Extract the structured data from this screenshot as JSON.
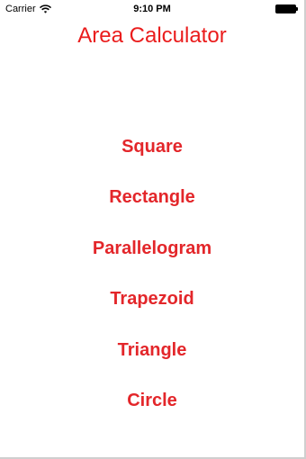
{
  "status_bar": {
    "carrier": "Carrier",
    "time": "9:10 PM",
    "wifi_icon": "wifi-icon",
    "battery_icon": "battery-icon"
  },
  "title": "Area Calculator",
  "accent_color": "#e3262a",
  "menu": {
    "items": [
      {
        "label": "Square"
      },
      {
        "label": "Rectangle"
      },
      {
        "label": "Parallelogram"
      },
      {
        "label": "Trapezoid"
      },
      {
        "label": "Triangle"
      },
      {
        "label": "Circle"
      }
    ]
  }
}
